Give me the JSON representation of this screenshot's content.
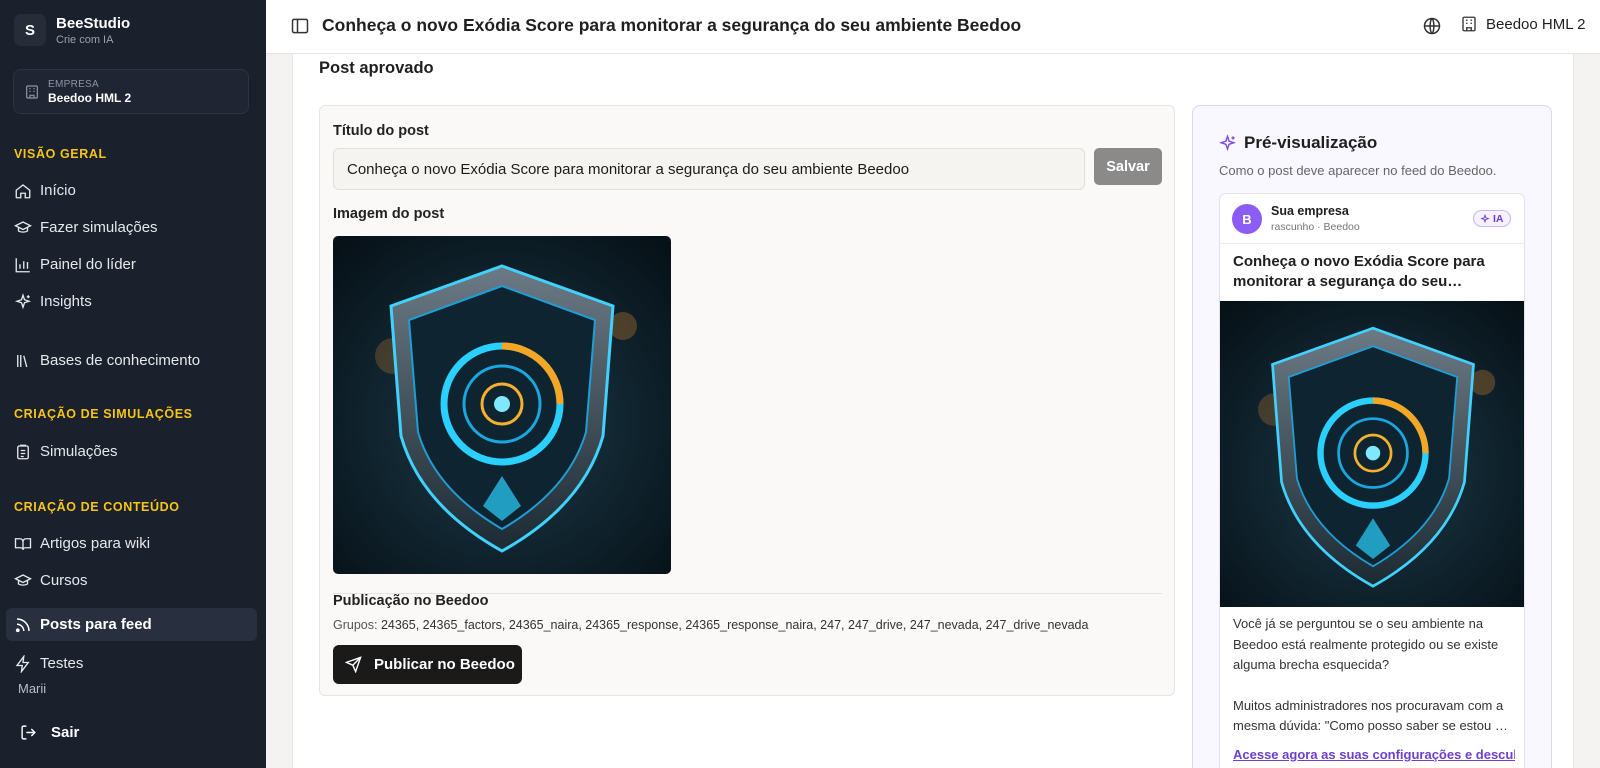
{
  "brand": {
    "initial": "S",
    "name": "BeeStudio",
    "tagline": "Crie com IA"
  },
  "company": {
    "label": "EMPRESA",
    "name": "Beedoo HML 2"
  },
  "sidebar": {
    "sections": [
      {
        "title": "VISÃO GERAL"
      },
      {
        "title": "CRIAÇÃO DE SIMULAÇÕES"
      },
      {
        "title": "CRIAÇÃO DE CONTEÚDO"
      }
    ],
    "items": [
      {
        "label": "Início",
        "icon": "home-icon"
      },
      {
        "label": "Fazer simulações",
        "icon": "graduation-cap-icon"
      },
      {
        "label": "Painel do líder",
        "icon": "bar-chart-icon"
      },
      {
        "label": "Insights",
        "icon": "sparkles-icon"
      },
      {
        "label": "Bases de conhecimento",
        "icon": "library-icon"
      },
      {
        "label": "Simulações",
        "icon": "clipboard-icon"
      },
      {
        "label": "Artigos para wiki",
        "icon": "book-open-icon"
      },
      {
        "label": "Cursos",
        "icon": "graduation-cap-icon"
      },
      {
        "label": "Posts para feed",
        "icon": "rss-icon",
        "active": true
      },
      {
        "label": "Testes",
        "icon": "zap-icon"
      }
    ],
    "user": "Marii",
    "logout": "Sair"
  },
  "header": {
    "title": "Conheça o novo Exódia Score para monitorar a segurança do seu ambiente Beedoo",
    "tenant": "Beedoo HML 2"
  },
  "main": {
    "status": "Post aprovado",
    "title_label": "Título do post",
    "title_value": "Conheça o novo Exódia Score para monitorar a segurança do seu ambiente Beedoo",
    "save_label": "Salvar",
    "image_label": "Imagem do post",
    "publication_label": "Publicação no Beedoo",
    "groups_prefix": "Grupos:",
    "groups_value": "24365, 24365_factors, 24365_naira, 24365_response, 24365_response_naira, 247, 247_drive, 247_nevada, 247_drive_nevada",
    "publish_label": "Publicar no Beedoo"
  },
  "preview": {
    "heading": "Pré-visualização",
    "subtitle": "Como o post deve aparecer no feed do Beedoo.",
    "avatar": "B",
    "author": "Sua empresa",
    "meta": "rascunho · Beedoo",
    "badge": "IA",
    "post_title": "Conheça o novo Exódia Score para monitorar a segurança do seu ambiente Beedoo",
    "paragraph1": "Você já se perguntou se o seu ambiente na Beedoo está realmente protegido ou se existe alguma brecha esquecida?",
    "paragraph2": "Muitos administradores nos procuravam com a mesma dúvida: \"Como posso saber se estou …",
    "link": "Acesse agora as suas configurações e descubra"
  },
  "colors": {
    "sidebar_bg": "#1a202c",
    "section_accent": "#f5c518",
    "preview_accent": "#7c4ddb",
    "publish_bg": "#1a1a1a"
  }
}
